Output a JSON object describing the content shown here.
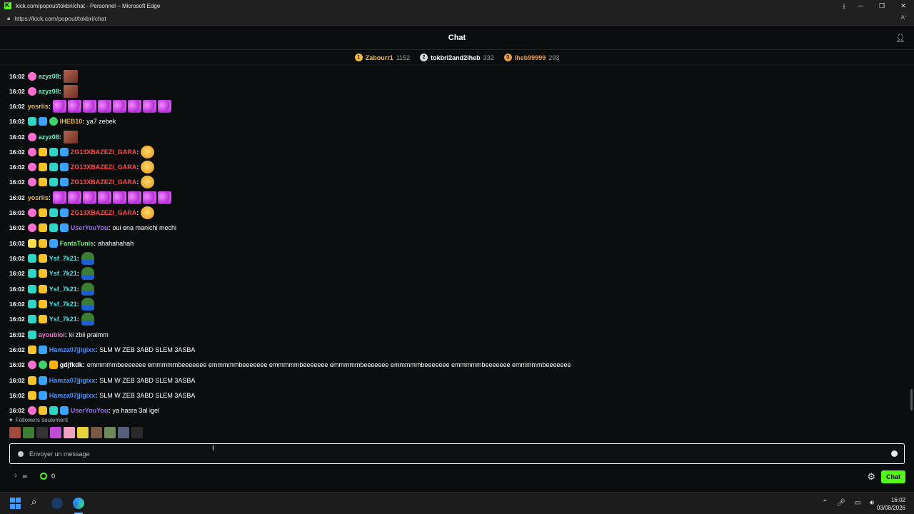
{
  "browser": {
    "title": "kick.com/popout/tokbri/chat - Personnel – Microsoft Edge",
    "url": "https://kick.com/popout/tokbri/chat",
    "minimize": "─",
    "maximize": "❐",
    "close": "✕"
  },
  "header": {
    "title": "Chat"
  },
  "leaderboard": [
    {
      "rank": "1",
      "name": "Zabourr1",
      "count": "1152",
      "medal_color": "#f5b841",
      "name_color": "#f5b841"
    },
    {
      "rank": "2",
      "name": "tokbri2and2iheb",
      "count": "332",
      "medal_color": "#d9d9d9",
      "name_color": "#ffffff"
    },
    {
      "rank": "3",
      "name": "iheb99999",
      "count": "293",
      "medal_color": "#e09a52",
      "name_color": "#e09a52"
    }
  ],
  "colors": {
    "azyz08": "#75f0c4",
    "yosriis": "#f5b841",
    "IHEB10": "#f5b841",
    "ZG13": "#ff4b4b",
    "UserYouYou": "#a16cff",
    "FantaTunis": "#75f07a",
    "Ysf": "#45e6e6",
    "ayoubloi": "#ff6fd2",
    "Hamza": "#4a90ff",
    "gdjfkdk": "#ffffff",
    "accent": "#53fc18"
  },
  "messages": [
    {
      "time": "16:02",
      "user": "azyz08",
      "text": ""
    },
    {
      "time": "16:02",
      "user": "azyz08",
      "text": ""
    },
    {
      "time": "16:02",
      "user": "yosriis",
      "text": ""
    },
    {
      "time": "16:02",
      "user": "IHEB10",
      "text": "ya7 zebek"
    },
    {
      "time": "16:02",
      "user": "azyz08",
      "text": ""
    },
    {
      "time": "16:02",
      "user": "ZG13XBAZEZI_GARA",
      "text": ""
    },
    {
      "time": "16:02",
      "user": "ZG13XBAZEZI_GARA",
      "text": ""
    },
    {
      "time": "16:02",
      "user": "ZG13XBAZEZI_GARA",
      "text": ""
    },
    {
      "time": "16:02",
      "user": "yosriis",
      "text": ""
    },
    {
      "time": "16:02",
      "user": "ZG13XBAZEZI_GARA",
      "text": ""
    },
    {
      "time": "16:02",
      "user": "UserYouYou",
      "text": "oui ena manichi mechi"
    },
    {
      "time": "16:02",
      "user": "FantaTunis",
      "text": "ahahahahah"
    },
    {
      "time": "16:02",
      "user": "Ysf_7k21",
      "text": ""
    },
    {
      "time": "16:02",
      "user": "Ysf_7k21",
      "text": ""
    },
    {
      "time": "16:02",
      "user": "Ysf_7k21",
      "text": ""
    },
    {
      "time": "16:02",
      "user": "Ysf_7k21",
      "text": ""
    },
    {
      "time": "16:02",
      "user": "Ysf_7k21",
      "text": ""
    },
    {
      "time": "16:02",
      "user": "ayoubloi",
      "text": "ki zbii praimm"
    },
    {
      "time": "16:02",
      "user": "Hamza07jjigixx",
      "text": "SLM W ZEB 3ABD SLEM 3ASBA"
    },
    {
      "time": "16:02",
      "user": "gdjfkdk",
      "text": "emmmmmbeeeeeee emmmmmbeeeeeee emmmmmbeeeeeee emmmmmbeeeeeee emmmmmbeeeeeee emmmmmbeeeeeee emmmmmbeeeeeee emmmmmbeeeeeee"
    },
    {
      "time": "16:02",
      "user": "Hamza07jjigixx",
      "text": "SLM W ZEB 3ABD SLEM 3ASBA"
    },
    {
      "time": "16:02",
      "user": "Hamza07jjigixx",
      "text": "SLM W ZEB 3ABD SLEM 3ASBA"
    },
    {
      "time": "16:02",
      "user": "UserYouYou",
      "text": "ya hasra 3al igel"
    }
  ],
  "footer": {
    "followers_only": "Followers seulement",
    "input_placeholder": "Envoyer un message",
    "infinity": "∞",
    "points": "0",
    "chat_button": "Chat"
  },
  "clock": {
    "time": "16:02",
    "date": "03/08/2026"
  }
}
